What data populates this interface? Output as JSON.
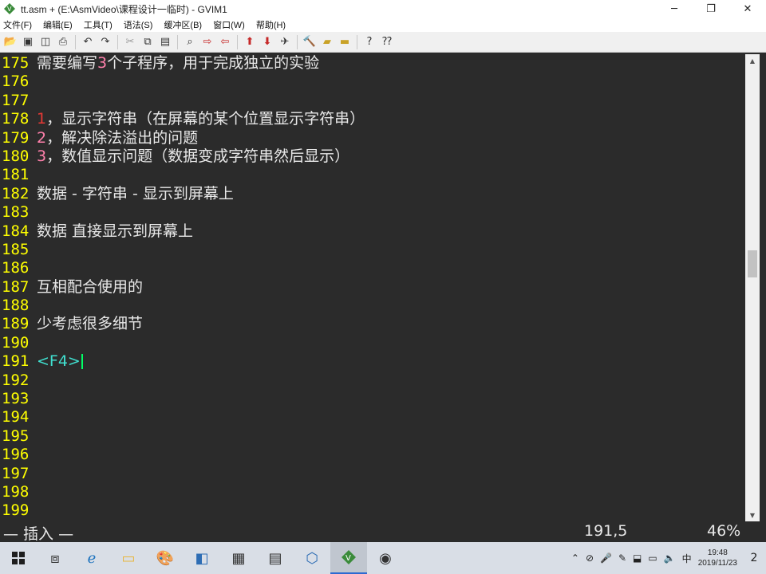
{
  "window": {
    "title": "tt.asm + (E:\\AsmVideo\\课程设计一临时) - GVIM1",
    "minimize": "─",
    "restore": "❐",
    "close": "✕"
  },
  "menu": [
    "文件(F)",
    "编辑(E)",
    "工具(T)",
    "语法(S)",
    "缓冲区(B)",
    "窗口(W)",
    "帮助(H)"
  ],
  "toolbar": {
    "icons": [
      "open-icon",
      "save-icon",
      "save-all-icon",
      "print-icon",
      "undo-icon",
      "redo-icon",
      "cut-icon",
      "copy-icon",
      "paste-icon",
      "find-replace-icon",
      "find-next-icon",
      "find-prev-icon",
      "load-session-icon",
      "save-session-icon",
      "run-script-icon",
      "make-icon",
      "shell-icon",
      "tag-jump-icon",
      "help-icon",
      "find-help-icon"
    ]
  },
  "editor": {
    "lines": [
      {
        "num": "175",
        "segments": [
          {
            "t": "需要编写",
            "c": ""
          },
          {
            "t": "3",
            "c": "pink"
          },
          {
            "t": "个子程序，用于完成独立的实验",
            "c": ""
          }
        ]
      },
      {
        "num": "176",
        "segments": []
      },
      {
        "num": "177",
        "segments": []
      },
      {
        "num": "178",
        "segments": [
          {
            "t": "1",
            "c": "red"
          },
          {
            "t": "，显示字符串（在屏幕的某个位置显示字符串）",
            "c": ""
          }
        ]
      },
      {
        "num": "179",
        "segments": [
          {
            "t": "2",
            "c": "pink"
          },
          {
            "t": "，解决除法溢出的问题",
            "c": ""
          }
        ]
      },
      {
        "num": "180",
        "segments": [
          {
            "t": "3",
            "c": "pink"
          },
          {
            "t": "，数值显示问题（数据变成字符串然后显示）",
            "c": ""
          }
        ]
      },
      {
        "num": "181",
        "segments": []
      },
      {
        "num": "182",
        "segments": [
          {
            "t": "数据 - 字符串 - 显示到屏幕上",
            "c": ""
          }
        ]
      },
      {
        "num": "183",
        "segments": []
      },
      {
        "num": "184",
        "segments": [
          {
            "t": "数据 直接显示到屏幕上",
            "c": ""
          }
        ]
      },
      {
        "num": "185",
        "segments": []
      },
      {
        "num": "186",
        "segments": []
      },
      {
        "num": "187",
        "segments": [
          {
            "t": "互相配合使用的",
            "c": ""
          }
        ]
      },
      {
        "num": "188",
        "segments": []
      },
      {
        "num": "189",
        "segments": [
          {
            "t": "少考虑很多细节",
            "c": ""
          }
        ]
      },
      {
        "num": "190",
        "segments": []
      },
      {
        "num": "191",
        "segments": [
          {
            "t": "<F4>",
            "c": "cyan"
          }
        ],
        "cursor": true
      },
      {
        "num": "192",
        "segments": []
      },
      {
        "num": "193",
        "segments": []
      },
      {
        "num": "194",
        "segments": []
      },
      {
        "num": "195",
        "segments": []
      },
      {
        "num": "196",
        "segments": []
      },
      {
        "num": "197",
        "segments": []
      },
      {
        "num": "198",
        "segments": []
      },
      {
        "num": "199",
        "segments": []
      }
    ]
  },
  "status": {
    "mode": "— 插入 —",
    "position": "191,5",
    "percent": "46%"
  },
  "taskbar": {
    "apps": [
      "start-icon",
      "task-view-icon",
      "edge-icon",
      "file-explorer-icon",
      "paint-icon",
      "app-icon",
      "minecraft-icon",
      "calculator-icon",
      "virtualbox-icon",
      "gvim-icon",
      "obs-icon"
    ],
    "tray_ime": "中",
    "time": "19:48",
    "date": "2019/11/23",
    "notifications": "2"
  }
}
